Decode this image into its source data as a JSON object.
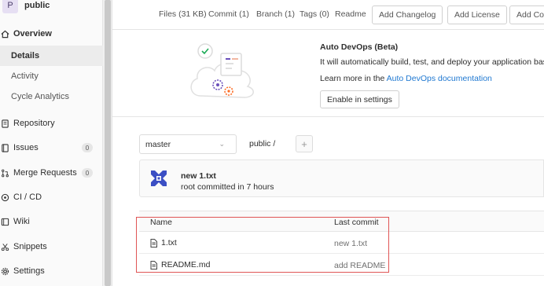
{
  "project": {
    "avatar_letter": "P",
    "name": "public"
  },
  "sidebar": {
    "overview": "Overview",
    "sub_items": [
      {
        "label": "Details"
      },
      {
        "label": "Activity"
      },
      {
        "label": "Cycle Analytics"
      }
    ],
    "items": [
      {
        "label": "Repository",
        "icon": "repository-icon"
      },
      {
        "label": "Issues",
        "icon": "issues-icon",
        "count": "0"
      },
      {
        "label": "Merge Requests",
        "icon": "merge-request-icon",
        "count": "0"
      },
      {
        "label": "CI / CD",
        "icon": "rocket-icon"
      },
      {
        "label": "Wiki",
        "icon": "book-icon"
      },
      {
        "label": "Snippets",
        "icon": "scissors-icon"
      },
      {
        "label": "Settings",
        "icon": "gear-icon"
      }
    ]
  },
  "stats": {
    "files": "Files (31 KB)",
    "commit": "Commit (1)",
    "branch": "Branch (1)",
    "tags": "Tags (0)",
    "readme": "Readme",
    "add_changelog": "Add Changelog",
    "add_license": "Add License",
    "add_contributing": "Add Cor"
  },
  "devops": {
    "title": "Auto DevOps (Beta)",
    "description": "It will automatically build, test, and deploy your application based",
    "learn_prefix": "Learn more in the ",
    "learn_link": "Auto DevOps documentation",
    "enable_button": "Enable in settings"
  },
  "repo": {
    "branch": "master",
    "breadcrumb": "public /",
    "add_button": "+"
  },
  "last_commit": {
    "title": "new 1.txt",
    "meta": "root committed in 7 hours"
  },
  "table": {
    "headers": {
      "name": "Name",
      "last_commit": "Last commit"
    },
    "rows": [
      {
        "name": "1.txt",
        "commit": "new 1.txt"
      },
      {
        "name": "README.md",
        "commit": "add README"
      }
    ]
  }
}
